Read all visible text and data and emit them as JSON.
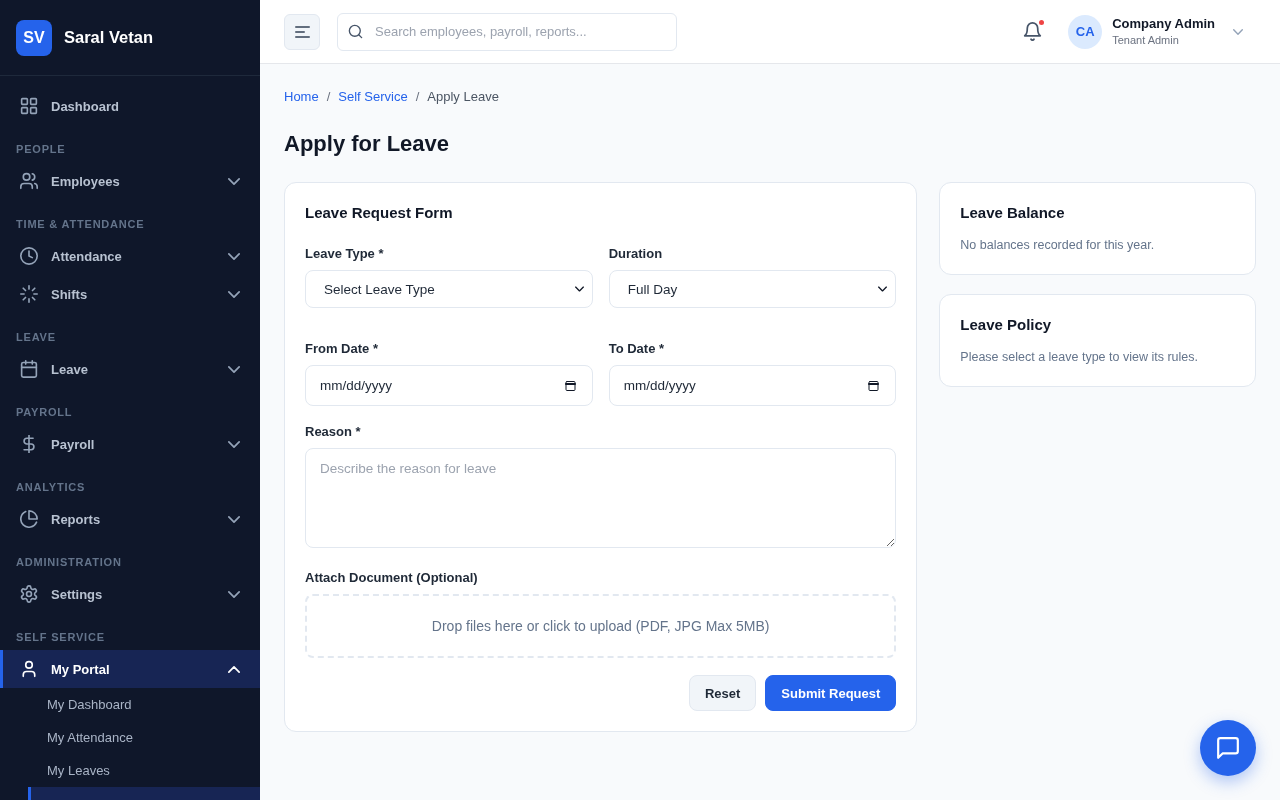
{
  "sidebar": {
    "brand": {
      "initials": "SV",
      "name": "Saral Vetan"
    },
    "sections": [
      {
        "items": [
          {
            "kind": "link",
            "label": "Dashboard",
            "selected": false
          }
        ]
      },
      {
        "heading": "PEOPLE",
        "items": [
          {
            "kind": "menu",
            "label": "Employees",
            "selected": false,
            "expanded": false
          }
        ]
      },
      {
        "heading": "TIME & ATTENDANCE",
        "items": [
          {
            "kind": "menu",
            "label": "Attendance",
            "selected": false,
            "expanded": false
          },
          {
            "kind": "menu",
            "label": "Shifts",
            "selected": false,
            "expanded": false
          }
        ]
      },
      {
        "heading": "LEAVE",
        "items": [
          {
            "kind": "menu",
            "label": "Leave",
            "selected": false,
            "expanded": false
          }
        ]
      },
      {
        "heading": "PAYROLL",
        "items": [
          {
            "kind": "menu",
            "label": "Payroll",
            "selected": false,
            "expanded": false
          }
        ]
      },
      {
        "heading": "ANALYTICS",
        "items": [
          {
            "kind": "menu",
            "label": "Reports",
            "selected": false,
            "expanded": false
          }
        ]
      },
      {
        "heading": "ADMINISTRATION",
        "items": [
          {
            "kind": "menu",
            "label": "Settings",
            "selected": false,
            "expanded": false
          }
        ]
      },
      {
        "heading": "SELF SERVICE",
        "items": [
          {
            "kind": "menu",
            "label": "My Portal",
            "selected": true,
            "expanded": true,
            "children": [
              {
                "label": "My Dashboard",
                "selected": false
              },
              {
                "label": "My Attendance",
                "selected": false
              },
              {
                "label": "My Leaves",
                "selected": false
              },
              {
                "selected": true
              }
            ]
          }
        ]
      }
    ]
  },
  "header": {
    "search": {
      "placeholder": "Search employees, payroll, reports..."
    },
    "notifications": {
      "unread": true
    },
    "user": {
      "initials": "CA",
      "name": "Company Admin",
      "role": "Tenant Admin"
    }
  },
  "breadcrumb": [
    {
      "kind": "link",
      "label": "Home"
    },
    {
      "kind": "separator",
      "label": "/"
    },
    {
      "kind": "link",
      "label": "Self Service"
    },
    {
      "kind": "separator",
      "label": "/"
    },
    {
      "kind": "current",
      "label": "Apply Leave"
    }
  ],
  "title": "Apply for Leave",
  "form": {
    "title": "Leave Request Form",
    "fields": [
      {
        "kind": "select",
        "label": "Leave Type *",
        "value": "Select Leave Type"
      },
      {
        "kind": "select",
        "label": "Duration",
        "value": "Full Day"
      },
      {
        "kind": "date",
        "label": "From Date *",
        "placeholder": "mm/dd/yyyy"
      },
      {
        "kind": "date",
        "label": "To Date *",
        "placeholder": "mm/dd/yyyy"
      },
      {
        "kind": "textarea",
        "label": "Reason *",
        "placeholder": "Describe the reason for leave"
      },
      {
        "kind": "upload",
        "label": "Attach Document (Optional)",
        "text": "Drop files here or click to upload (PDF, JPG Max 5MB)"
      }
    ],
    "buttons": [
      {
        "kind": "secondary",
        "label": "Reset"
      },
      {
        "kind": "primary",
        "label": "Submit Request"
      }
    ]
  },
  "panels": [
    {
      "title": "Leave Balance",
      "text": "No balances recorded for this year."
    },
    {
      "title": "Leave Policy",
      "text": "Please select a leave type to view its rules."
    }
  ]
}
